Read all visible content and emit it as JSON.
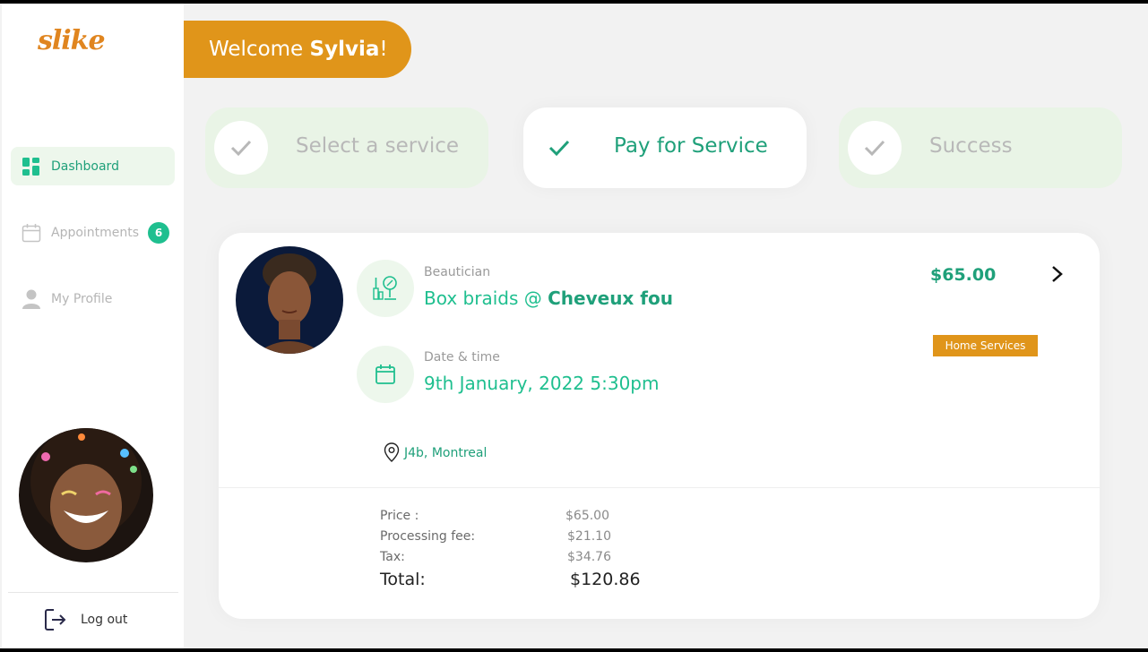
{
  "sidebar": {
    "logo": "slike",
    "items": [
      {
        "label": "Dashboard",
        "icon": "dashboard-icon",
        "active": true
      },
      {
        "label": "Appointments",
        "icon": "calendar-icon",
        "badge": "6"
      },
      {
        "label": "My Profile",
        "icon": "user-icon"
      }
    ],
    "logout_label": "Log out"
  },
  "header": {
    "welcome_prefix": "Welcome ",
    "user_name": "Sylvia",
    "welcome_suffix": "!"
  },
  "steps": [
    {
      "label": "Select a service",
      "state": "done"
    },
    {
      "label": "Pay for Service",
      "state": "active"
    },
    {
      "label": "Success",
      "state": "pending"
    }
  ],
  "booking": {
    "service_caption": "Beautician",
    "service_name": "Box braids @ ",
    "salon_name": "Cheveux fou",
    "datetime_caption": "Date & time",
    "datetime_value": "9th January, 2022 5:30pm",
    "price": "$65.00",
    "tag": "Home Services",
    "location": "J4b, Montreal"
  },
  "summary": {
    "price_label": "Price :",
    "price_value": "$65.00",
    "fee_label": "Processing fee:",
    "fee_value": "$21.10",
    "tax_label": "Tax:",
    "tax_value": "$34.76",
    "total_label": "Total:",
    "total_value": "$120.86"
  },
  "colors": {
    "accent_green": "#1fa07a",
    "accent_orange": "#e0951a",
    "light_green": "#edf7ec"
  }
}
